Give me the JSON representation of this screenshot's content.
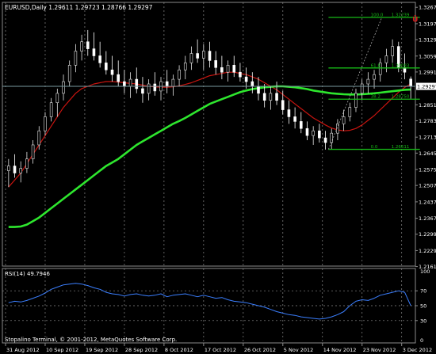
{
  "colors": {
    "background": "#000000",
    "frame": "#8a8a8a",
    "grid": "#8a8a8a",
    "text": "#ffffff",
    "bull_candle": "#e6e6e6",
    "bear_candle": "#ffffff",
    "ma_fast": "#c8140f",
    "ma_slow": "#2ee62e",
    "fib": "#16b816",
    "price_line": "#7a9aa0",
    "rsi": "#3b7fff",
    "arrow": "#d11a1a"
  },
  "main_chart": {
    "header": "EURUSD,Daily  1.29611 1.29723 1.28766 1.29297",
    "current_price_label": "1.29297",
    "arrow_glyph": "Û"
  },
  "rsi_panel": {
    "header": "RSI(14) 49.7946"
  },
  "footer": {
    "copyright": "Stopalino Terminal, © 2001-2012, MetaQuotes Software Corp."
  },
  "chart_data": [
    {
      "type": "candlestick",
      "symbol": "EURUSD",
      "timeframe": "Daily",
      "ohlc_header": {
        "open": 1.29611,
        "high": 1.29723,
        "low": 1.28766,
        "close": 1.29297
      },
      "current_price": 1.29297,
      "ylim": [
        1.2163,
        1.3288
      ],
      "y_tick_labels": [
        "1.32670",
        "1.31970",
        "1.31290",
        "1.30590",
        "1.29910",
        "1.28510",
        "1.27830",
        "1.27130",
        "1.26450",
        "1.25750",
        "1.25070",
        "1.24370",
        "1.23670",
        "1.22990",
        "1.22290",
        "1.21610"
      ],
      "x_tick_labels": [
        "31 Aug 2012",
        "10 Sep 2012",
        "19 Sep 2012",
        "28 Sep 2012",
        "8 Oct 2012",
        "17 Oct 2012",
        "26 Oct 2012",
        "5 Nov 2012",
        "14 Nov 2012",
        "23 Nov 2012",
        "3 Dec 2012"
      ],
      "candles": [
        {
          "o": 1.257,
          "h": 1.262,
          "l": 1.25,
          "c": 1.259
        },
        {
          "o": 1.259,
          "h": 1.264,
          "l": 1.254,
          "c": 1.256
        },
        {
          "o": 1.256,
          "h": 1.261,
          "l": 1.252,
          "c": 1.258
        },
        {
          "o": 1.258,
          "h": 1.265,
          "l": 1.256,
          "c": 1.262
        },
        {
          "o": 1.262,
          "h": 1.27,
          "l": 1.26,
          "c": 1.268
        },
        {
          "o": 1.268,
          "h": 1.276,
          "l": 1.266,
          "c": 1.274
        },
        {
          "o": 1.274,
          "h": 1.282,
          "l": 1.272,
          "c": 1.28
        },
        {
          "o": 1.28,
          "h": 1.288,
          "l": 1.278,
          "c": 1.286
        },
        {
          "o": 1.286,
          "h": 1.292,
          "l": 1.28,
          "c": 1.29
        },
        {
          "o": 1.29,
          "h": 1.298,
          "l": 1.287,
          "c": 1.295
        },
        {
          "o": 1.295,
          "h": 1.304,
          "l": 1.293,
          "c": 1.302
        },
        {
          "o": 1.302,
          "h": 1.311,
          "l": 1.299,
          "c": 1.308
        },
        {
          "o": 1.308,
          "h": 1.315,
          "l": 1.304,
          "c": 1.312
        },
        {
          "o": 1.312,
          "h": 1.317,
          "l": 1.306,
          "c": 1.309
        },
        {
          "o": 1.309,
          "h": 1.316,
          "l": 1.304,
          "c": 1.306
        },
        {
          "o": 1.306,
          "h": 1.312,
          "l": 1.301,
          "c": 1.303
        },
        {
          "o": 1.303,
          "h": 1.308,
          "l": 1.298,
          "c": 1.3
        },
        {
          "o": 1.3,
          "h": 1.306,
          "l": 1.295,
          "c": 1.298
        },
        {
          "o": 1.298,
          "h": 1.304,
          "l": 1.293,
          "c": 1.295
        },
        {
          "o": 1.295,
          "h": 1.3,
          "l": 1.29,
          "c": 1.293
        },
        {
          "o": 1.293,
          "h": 1.299,
          "l": 1.288,
          "c": 1.296
        },
        {
          "o": 1.296,
          "h": 1.301,
          "l": 1.29,
          "c": 1.292
        },
        {
          "o": 1.292,
          "h": 1.297,
          "l": 1.286,
          "c": 1.29
        },
        {
          "o": 1.29,
          "h": 1.296,
          "l": 1.287,
          "c": 1.294
        },
        {
          "o": 1.294,
          "h": 1.299,
          "l": 1.289,
          "c": 1.291
        },
        {
          "o": 1.291,
          "h": 1.297,
          "l": 1.287,
          "c": 1.295
        },
        {
          "o": 1.295,
          "h": 1.3,
          "l": 1.29,
          "c": 1.293
        },
        {
          "o": 1.293,
          "h": 1.298,
          "l": 1.289,
          "c": 1.296
        },
        {
          "o": 1.296,
          "h": 1.302,
          "l": 1.293,
          "c": 1.3
        },
        {
          "o": 1.3,
          "h": 1.306,
          "l": 1.296,
          "c": 1.303
        },
        {
          "o": 1.303,
          "h": 1.31,
          "l": 1.3,
          "c": 1.307
        },
        {
          "o": 1.307,
          "h": 1.313,
          "l": 1.303,
          "c": 1.305
        },
        {
          "o": 1.305,
          "h": 1.311,
          "l": 1.3,
          "c": 1.308
        },
        {
          "o": 1.308,
          "h": 1.312,
          "l": 1.301,
          "c": 1.304
        },
        {
          "o": 1.304,
          "h": 1.308,
          "l": 1.298,
          "c": 1.301
        },
        {
          "o": 1.301,
          "h": 1.306,
          "l": 1.296,
          "c": 1.299
        },
        {
          "o": 1.299,
          "h": 1.304,
          "l": 1.295,
          "c": 1.302
        },
        {
          "o": 1.302,
          "h": 1.306,
          "l": 1.297,
          "c": 1.299
        },
        {
          "o": 1.299,
          "h": 1.303,
          "l": 1.295,
          "c": 1.297
        },
        {
          "o": 1.297,
          "h": 1.301,
          "l": 1.292,
          "c": 1.295
        },
        {
          "o": 1.295,
          "h": 1.299,
          "l": 1.29,
          "c": 1.293
        },
        {
          "o": 1.293,
          "h": 1.297,
          "l": 1.287,
          "c": 1.29
        },
        {
          "o": 1.29,
          "h": 1.294,
          "l": 1.284,
          "c": 1.287
        },
        {
          "o": 1.287,
          "h": 1.293,
          "l": 1.283,
          "c": 1.29
        },
        {
          "o": 1.29,
          "h": 1.295,
          "l": 1.285,
          "c": 1.287
        },
        {
          "o": 1.287,
          "h": 1.291,
          "l": 1.281,
          "c": 1.283
        },
        {
          "o": 1.283,
          "h": 1.287,
          "l": 1.277,
          "c": 1.28
        },
        {
          "o": 1.28,
          "h": 1.284,
          "l": 1.275,
          "c": 1.278
        },
        {
          "o": 1.278,
          "h": 1.282,
          "l": 1.273,
          "c": 1.275
        },
        {
          "o": 1.275,
          "h": 1.278,
          "l": 1.27,
          "c": 1.272
        },
        {
          "o": 1.272,
          "h": 1.276,
          "l": 1.268,
          "c": 1.274
        },
        {
          "o": 1.274,
          "h": 1.277,
          "l": 1.269,
          "c": 1.271
        },
        {
          "o": 1.271,
          "h": 1.274,
          "l": 1.266,
          "c": 1.269
        },
        {
          "o": 1.269,
          "h": 1.275,
          "l": 1.2662,
          "c": 1.273
        },
        {
          "o": 1.273,
          "h": 1.279,
          "l": 1.27,
          "c": 1.277
        },
        {
          "o": 1.277,
          "h": 1.283,
          "l": 1.274,
          "c": 1.28
        },
        {
          "o": 1.28,
          "h": 1.286,
          "l": 1.278,
          "c": 1.284
        },
        {
          "o": 1.284,
          "h": 1.292,
          "l": 1.282,
          "c": 1.29
        },
        {
          "o": 1.29,
          "h": 1.296,
          "l": 1.287,
          "c": 1.294
        },
        {
          "o": 1.294,
          "h": 1.299,
          "l": 1.29,
          "c": 1.296
        },
        {
          "o": 1.296,
          "h": 1.3,
          "l": 1.292,
          "c": 1.298
        },
        {
          "o": 1.298,
          "h": 1.305,
          "l": 1.295,
          "c": 1.303
        },
        {
          "o": 1.303,
          "h": 1.309,
          "l": 1.299,
          "c": 1.306
        },
        {
          "o": 1.306,
          "h": 1.313,
          "l": 1.303,
          "c": 1.31
        },
        {
          "o": 1.31,
          "h": 1.312,
          "l": 1.299,
          "c": 1.301
        },
        {
          "o": 1.301,
          "h": 1.307,
          "l": 1.296,
          "c": 1.299
        },
        {
          "o": 1.2961,
          "h": 1.2972,
          "l": 1.2877,
          "c": 1.293
        }
      ],
      "moving_averages": [
        {
          "name": "",
          "color": "red",
          "values": [
            1.25,
            1.253,
            1.256,
            1.26,
            1.264,
            1.268,
            1.272,
            1.276,
            1.28,
            1.284,
            1.287,
            1.29,
            1.292,
            1.293,
            1.294,
            1.2945,
            1.295,
            1.295,
            1.2948,
            1.2945,
            1.2942,
            1.294,
            1.2935,
            1.293,
            1.2928,
            1.2926,
            1.2926,
            1.2928,
            1.2932,
            1.2938,
            1.2945,
            1.2955,
            1.2965,
            1.2975,
            1.298,
            1.2985,
            1.299,
            1.299,
            1.2985,
            1.298,
            1.297,
            1.296,
            1.2945,
            1.293,
            1.2915,
            1.2895,
            1.2875,
            1.2855,
            1.2835,
            1.2815,
            1.2795,
            1.278,
            1.2765,
            1.2752,
            1.2744,
            1.274,
            1.2742,
            1.275,
            1.2765,
            1.2785,
            1.2805,
            1.283,
            1.2855,
            1.288,
            1.2905,
            1.2925,
            1.294
          ]
        },
        {
          "name": "",
          "color": "green",
          "values": [
            1.233,
            1.233,
            1.2332,
            1.234,
            1.2355,
            1.237,
            1.239,
            1.241,
            1.243,
            1.245,
            1.247,
            1.249,
            1.251,
            1.253,
            1.255,
            1.257,
            1.259,
            1.2605,
            1.262,
            1.264,
            1.266,
            1.268,
            1.2695,
            1.271,
            1.2725,
            1.274,
            1.2755,
            1.277,
            1.2782,
            1.2795,
            1.281,
            1.2825,
            1.284,
            1.2855,
            1.2865,
            1.2875,
            1.2885,
            1.2895,
            1.2905,
            1.2912,
            1.2918,
            1.2922,
            1.2926,
            1.2928,
            1.293,
            1.293,
            1.2928,
            1.2926,
            1.2922,
            1.2918,
            1.2912,
            1.2908,
            1.2904,
            1.29,
            1.2898,
            1.2896,
            1.2895,
            1.2895,
            1.2896,
            1.2898,
            1.29,
            1.2903,
            1.2906,
            1.2909,
            1.2912,
            1.2915,
            1.2916
          ]
        }
      ],
      "fibonacci": {
        "levels": [
          {
            "label": "100.0",
            "price": "1.32239",
            "value": 1.32239
          },
          {
            "label": "61.8",
            "price": "1.30083",
            "value": 1.30083
          },
          {
            "label": "38.2",
            "price": "1.28750",
            "value": 1.2875
          },
          {
            "label": "0.0",
            "price": "1.26611",
            "value": 1.26611
          }
        ],
        "start_index": 53,
        "end_index": 66
      },
      "arrow": {
        "index": 66,
        "value": 1.3205
      }
    },
    {
      "type": "line",
      "name": "RSI(14)",
      "value": 49.7946,
      "ylim": [
        0,
        100
      ],
      "y_tick_labels": [
        "100",
        "70",
        "50",
        "30",
        "0"
      ],
      "levels": [
        70,
        50,
        30
      ],
      "values": [
        54,
        56,
        55,
        57,
        60,
        63,
        67,
        72,
        75,
        78,
        79,
        80,
        79,
        77,
        74,
        72,
        68,
        66,
        65,
        63,
        65,
        66,
        64,
        63,
        64,
        66,
        62,
        64,
        65,
        66,
        64,
        62,
        64,
        62,
        60,
        61,
        58,
        56,
        55,
        54,
        52,
        50,
        48,
        45,
        42,
        40,
        38,
        37,
        35,
        34,
        33,
        32,
        33,
        35,
        38,
        42,
        50,
        56,
        58,
        57,
        60,
        64,
        66,
        68,
        70,
        68,
        50
      ]
    }
  ]
}
